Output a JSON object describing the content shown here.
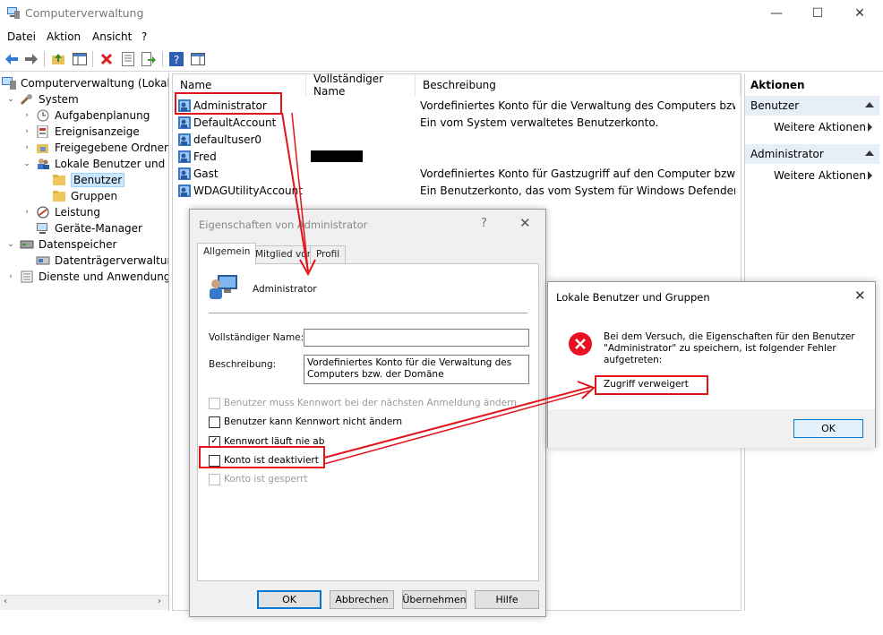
{
  "window": {
    "title": "Computerverwaltung",
    "controls": {
      "minimize": "—",
      "maximize": "☐",
      "close": "✕"
    }
  },
  "menu": [
    "Datei",
    "Aktion",
    "Ansicht",
    "?"
  ],
  "toolbar_icons": [
    "back-icon",
    "forward-icon",
    "up-folder-icon",
    "show-hide-tree-icon",
    "delete-icon",
    "properties-icon",
    "export-icon",
    "help-icon",
    "show-hide-action-pane-icon"
  ],
  "tree": {
    "root": "Computerverwaltung (Lokal)",
    "system": "System",
    "aufgaben": "Aufgabenplanung",
    "ereignis": "Ereignisanzeige",
    "ordner": "Freigegebene Ordner",
    "lokale": "Lokale Benutzer und Gr",
    "benutzer": "Benutzer",
    "gruppen": "Gruppen",
    "leistung": "Leistung",
    "geraete": "Geräte-Manager",
    "datenspeicher": "Datenspeicher",
    "datentraeger": "Datenträgerverwaltung",
    "dienste": "Dienste und Anwendungen"
  },
  "list": {
    "columns": [
      "Name",
      "Vollständiger Name",
      "Beschreibung"
    ],
    "rows": [
      {
        "name": "Administrator",
        "full": "",
        "desc": "Vordefiniertes Konto für die Verwaltung des Computers bzw. de..."
      },
      {
        "name": "DefaultAccount",
        "full": "",
        "desc": "Ein vom System verwaltetes Benutzerkonto."
      },
      {
        "name": "defaultuser0",
        "full": "",
        "desc": ""
      },
      {
        "name": "Fred",
        "full": "",
        "desc": ""
      },
      {
        "name": "Gast",
        "full": "",
        "desc": "Vordefiniertes Konto für Gastzugriff auf den Computer bzw. die..."
      },
      {
        "name": "WDAGUtilityAccount",
        "full": "",
        "desc": "Ein Benutzerkonto, das vom System für Windows Defender Ap..."
      }
    ]
  },
  "actions": {
    "header": "Aktionen",
    "sec1": "Benutzer",
    "sec1_item": "Weitere Aktionen",
    "sec2": "Administrator",
    "sec2_item": "Weitere Aktionen"
  },
  "properties_dialog": {
    "title": "Eigenschaften von Administrator",
    "help": "?",
    "close": "✕",
    "tabs": [
      "Allgemein",
      "Mitglied von",
      "Profil"
    ],
    "username": "Administrator",
    "full_name_label": "Vollständiger Name:",
    "full_name_value": "",
    "description_label": "Beschreibung:",
    "description_value": "Vordefiniertes Konto für die Verwaltung des Computers bzw. der Domäne",
    "checkboxes": [
      {
        "label": "Benutzer muss Kennwort bei der nächsten Anmeldung ändern",
        "checked": false,
        "disabled": true
      },
      {
        "label": "Benutzer kann Kennwort nicht ändern",
        "checked": false,
        "disabled": false
      },
      {
        "label": "Kennwort läuft nie ab",
        "checked": true,
        "disabled": false
      },
      {
        "label": "Konto ist deaktiviert",
        "checked": false,
        "disabled": false
      },
      {
        "label": "Konto ist gesperrt",
        "checked": false,
        "disabled": true
      }
    ],
    "buttons": {
      "ok": "OK",
      "cancel": "Abbrechen",
      "apply": "Übernehmen",
      "help": "Hilfe"
    }
  },
  "error_dialog": {
    "title": "Lokale Benutzer und Gruppen",
    "close": "✕",
    "message": "Bei dem Versuch, die Eigenschaften für den Benutzer \"Administrator\" zu speichern, ist folgender Fehler aufgetreten:",
    "error": "Zugriff verweigert",
    "ok": "OK"
  },
  "annotation_color": "#e1141c"
}
